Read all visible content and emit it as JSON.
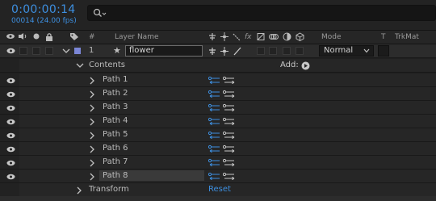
{
  "timeline": {
    "timecode": "0:00:00:14",
    "frame_info": "00014 (24.00 fps)",
    "search_placeholder": ""
  },
  "columns": {
    "hash": "#",
    "layer_name": "Layer Name",
    "fx": "fx",
    "mode": "Mode",
    "t": "T",
    "trkmat": "TrkMat"
  },
  "layer": {
    "number": "1",
    "name": "flower",
    "mode": "Normal",
    "label_color": "#7b86d6"
  },
  "contents": {
    "label": "Contents",
    "add_label": "Add:",
    "paths": [
      {
        "label": "Path 1"
      },
      {
        "label": "Path 2"
      },
      {
        "label": "Path 3"
      },
      {
        "label": "Path 4"
      },
      {
        "label": "Path 5"
      },
      {
        "label": "Path 6"
      },
      {
        "label": "Path 7"
      },
      {
        "label": "Path 8"
      }
    ]
  },
  "transform": {
    "label": "Transform",
    "reset_label": "Reset"
  },
  "colors": {
    "accent_blue": "#3d8fe0",
    "panel_bg": "#1f1f1f"
  }
}
